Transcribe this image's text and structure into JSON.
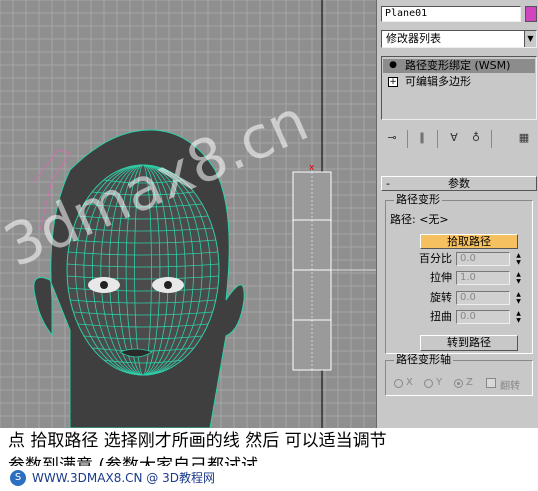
{
  "colors": {
    "viewport_bg": "#8f8f8f",
    "grid": "#a6a6a6",
    "wireframe": "#2ecfa8",
    "head": "#4a4a4a",
    "path_line": "#d070b0",
    "pick_button_active": "#f5c060",
    "object_color": "#d044c0"
  },
  "watermark": "3dmax8.cn",
  "panel": {
    "object_name": "Plane01",
    "modifier_list": "修改器列表",
    "stack": [
      {
        "label": "路径变形绑定 (WSM)",
        "icon": "lightbulb-icon",
        "selected": true
      },
      {
        "label": "可编辑多边形",
        "icon": "plus-box-icon",
        "selected": false
      }
    ],
    "toolbar_icons": [
      "pin-stack-icon",
      "show-end-result-icon",
      "make-unique-icon",
      "remove-modifier-icon",
      "configure-sets-icon"
    ],
    "rollout_title": "参数",
    "rollout_toggle": "-",
    "path_group": {
      "title": "路径变形",
      "path_label": "路径: <无>",
      "pick_button": "拾取路径",
      "fields": [
        {
          "label": "百分比",
          "value": "0.0"
        },
        {
          "label": "拉伸",
          "value": "1.0"
        },
        {
          "label": "旋转",
          "value": "0.0"
        },
        {
          "label": "扭曲",
          "value": "0.0"
        }
      ],
      "goto_button": "转到路径"
    },
    "axis_group": {
      "title": "路径变形轴",
      "axes": [
        "X",
        "Y",
        "Z"
      ],
      "selected_axis": "Z",
      "flip_label": "翻转"
    }
  },
  "caption": {
    "line1": "点  拾取路径  选择刚才所画的线  然后  可以适当调节",
    "line2": "参数到满意 (参数大家自己都试试"
  },
  "footer": {
    "logo": "S",
    "text": "WWW.3DMAX8.CN @ 3D教程网"
  }
}
